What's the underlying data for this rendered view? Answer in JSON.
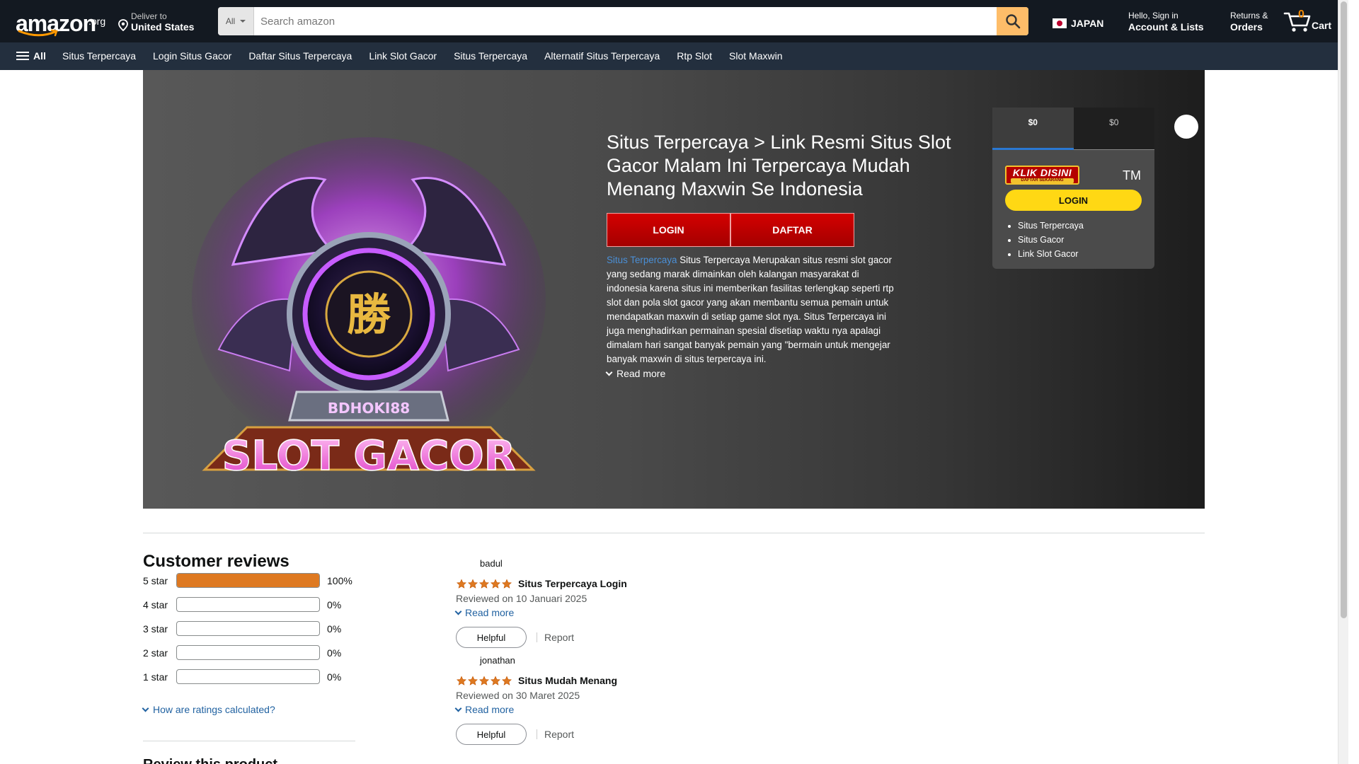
{
  "colors": {
    "nav_bg": "#131921",
    "subnav_bg": "#232f3e",
    "search_button": "#febd69",
    "cta_red": "#c00000",
    "yellow": "#ffd814",
    "star": "#de7921",
    "link": "#2162a1"
  },
  "header": {
    "logo_tld": ".org",
    "deliver_line1": "Deliver to",
    "deliver_line2": "United States",
    "search_category": "All",
    "search_placeholder": "Search amazon",
    "language": "JAPAN",
    "account_line1": "Hello, Sign in",
    "account_line2": "Account & Lists",
    "orders_line1": "Returns &",
    "orders_line2": "Orders",
    "cart_count": "0",
    "cart_label": "Cart"
  },
  "subnav": {
    "all_label": "All",
    "links": [
      "Situs Terpercaya",
      "Login Situs Gacor",
      "Daftar Situs Terpercaya",
      "Link Slot Gacor",
      "Situs Terpercaya",
      "Alternatif Situs Terpercaya",
      "Rtp Slot",
      "Slot Maxwin"
    ]
  },
  "hero": {
    "image_text_brand": "BDHOKI88",
    "image_text_main": "SLOT GACOR",
    "title": "Situs Terpercaya > Link Resmi Situs Slot Gacor Malam Ini Terpercaya Mudah Menang Maxwin Se Indonesia",
    "login_button": "LOGIN",
    "daftar_button": "DAFTAR",
    "desc_link": "Situs Terpercaya",
    "desc_text": " Situs Terpercaya Merupakan situs resmi slot gacor yang sedang marak dimainkan oleh kalangan masyarakat di indonesia karena situs ini memberikan fasilitas terlengkap seperti rtp slot dan pola slot gacor yang akan membantu semua pemain untuk mendapatkan maxwin di setiap game slot nya. Situs Terpercaya ini juga menghadirkan permainan spesial disetiap waktu nya apalagi dimalam hari sangat banyak pemain yang \"bermain untuk mengejar banyak maxwin di situs terpercaya ini.",
    "read_more": "Read more"
  },
  "panel": {
    "tabs": [
      "$0",
      "$0"
    ],
    "klik_line1": "KLIK DISINI",
    "klik_line2": "DAFTAR SEKARANG",
    "tm": "TM",
    "login_button": "LOGIN",
    "links": [
      "Situs Terpercaya",
      "Situs Gacor",
      "Link Slot Gacor"
    ]
  },
  "reviews": {
    "title": "Customer reviews",
    "histogram": [
      {
        "label": "5 star",
        "percent": 100,
        "percent_text": "100%"
      },
      {
        "label": "4 star",
        "percent": 0,
        "percent_text": "0%"
      },
      {
        "label": "3 star",
        "percent": 0,
        "percent_text": "0%"
      },
      {
        "label": "2 star",
        "percent": 0,
        "percent_text": "0%"
      },
      {
        "label": "1 star",
        "percent": 0,
        "percent_text": "0%"
      }
    ],
    "calc_link": "How are ratings calculated?",
    "next_section_title": "Review this product",
    "items": [
      {
        "user": "badul",
        "rating": 5,
        "title": "Situs Terpercaya Login",
        "date": "Reviewed on 10 Januari 2025",
        "read_more": "Read more",
        "helpful": "Helpful",
        "report": "Report"
      },
      {
        "user": "jonathan",
        "rating": 5,
        "title": "Situs Mudah Menang",
        "date": "Reviewed on 30 Maret 2025",
        "read_more": "Read more",
        "helpful": "Helpful",
        "report": "Report"
      }
    ]
  }
}
